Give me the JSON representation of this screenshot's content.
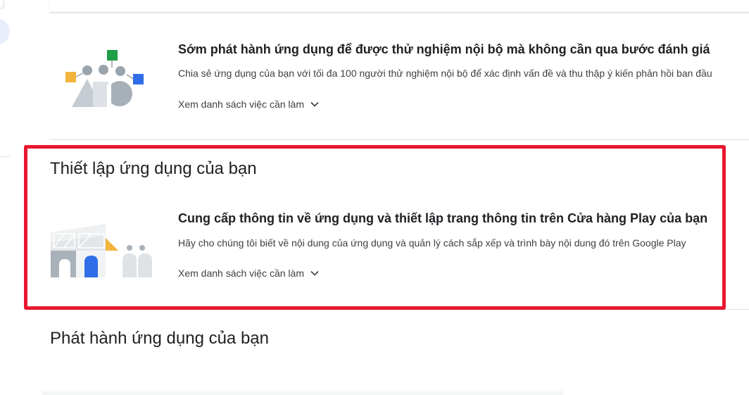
{
  "internal_testing_task": {
    "title": "Sớm phát hành ứng dụng để được thử nghiệm nội bộ mà không cần qua bước đánh giá",
    "description": "Chia sẻ ứng dụng của bạn với tối đa 100 người thử nghiệm nội bộ để xác định vấn đề và thu thập ý kiến phản hồi ban đầu",
    "view_tasks_label": "Xem danh sách việc cần làm",
    "illustration": "testers-illustration"
  },
  "setup_section": {
    "heading": "Thiết lập ứng dụng của bạn",
    "task": {
      "title": "Cung cấp thông tin về ứng dụng và thiết lập trang thông tin trên Cửa hàng Play của bạn",
      "description": "Hãy cho chúng tôi biết về nội dung của ứng dụng và quản lý cách sắp xếp và trình bày nội dung đó trên Google Play",
      "view_tasks_label": "Xem danh sách việc cần làm",
      "illustration": "store-setup-illustration"
    }
  },
  "release_section": {
    "heading": "Phát hành ứng dụng của bạn"
  },
  "colors": {
    "highlight": "#e8172f",
    "accent_blue": "#2f6ee8",
    "accent_green": "#1e9e47",
    "accent_yellow": "#f2b43a",
    "illustration_gray": "#bcc4cc"
  }
}
